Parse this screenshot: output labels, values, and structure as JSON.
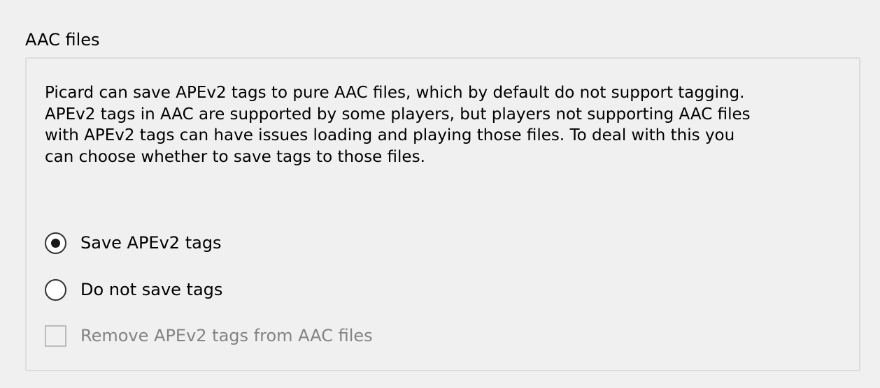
{
  "group": {
    "title": "AAC files",
    "description_lines": [
      "Picard can save APEv2 tags to pure AAC files, which by default do not support tagging.",
      "APEv2 tags in AAC are supported by some players, but players not supporting AAC files",
      "with APEv2 tags can have issues loading and playing those files. To deal with this you",
      "can choose whether to save tags to those files."
    ]
  },
  "options": {
    "save_tags": {
      "label": "Save APEv2 tags",
      "selected": true
    },
    "do_not_save": {
      "label": "Do not save tags",
      "selected": false
    },
    "remove_tags": {
      "label": "Remove APEv2 tags from AAC files",
      "checked": false,
      "enabled": false
    }
  },
  "colors": {
    "window_background": "#f0f0f0",
    "group_border": "#dcdcdc",
    "disabled_text": "#838383"
  }
}
